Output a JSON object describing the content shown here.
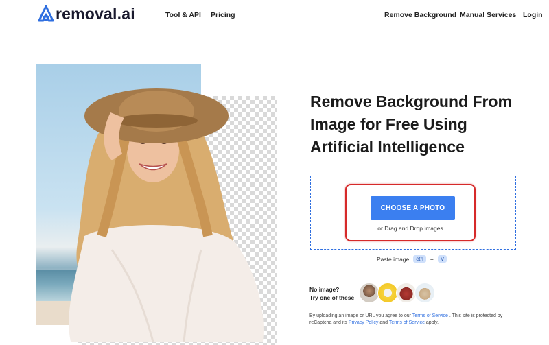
{
  "brand": {
    "name": "removal.ai",
    "accent": "#3b7ff0"
  },
  "nav": {
    "left": [
      {
        "label": "Tool & API"
      },
      {
        "label": "Pricing"
      }
    ],
    "right": [
      {
        "label": "Remove Background"
      },
      {
        "label": "Manual Services"
      },
      {
        "label": "Login"
      }
    ]
  },
  "hero": {
    "headline_lines": [
      "Remove Background From",
      "Image for Free Using",
      "Artificial Intelligence"
    ]
  },
  "upload": {
    "button_label": "CHOOSE A PHOTO",
    "drag_text": "or Drag and Drop images",
    "paste_label": "Paste image",
    "key_ctrl": "ctrl",
    "plus": "+",
    "key_v": "V"
  },
  "samples": {
    "prompt_line1": "No image?",
    "prompt_line2": "Try one of these",
    "items": [
      "sample-person",
      "sample-car",
      "sample-bag",
      "sample-animal"
    ]
  },
  "disclaimer": {
    "part1": "By uploading an image or URL you agree to our ",
    "terms": "Terms of Service",
    "part2": " . This site is protected by reCaptcha and its ",
    "privacy": "Privacy Policy",
    "part3": " and ",
    "terms2": "Terms of Service",
    "part4": " apply."
  },
  "colors": {
    "button": "#3b7ff0",
    "dropzone_border": "#2f6fe0",
    "highlight": "#d62a2a",
    "link": "#2f6fe0"
  }
}
